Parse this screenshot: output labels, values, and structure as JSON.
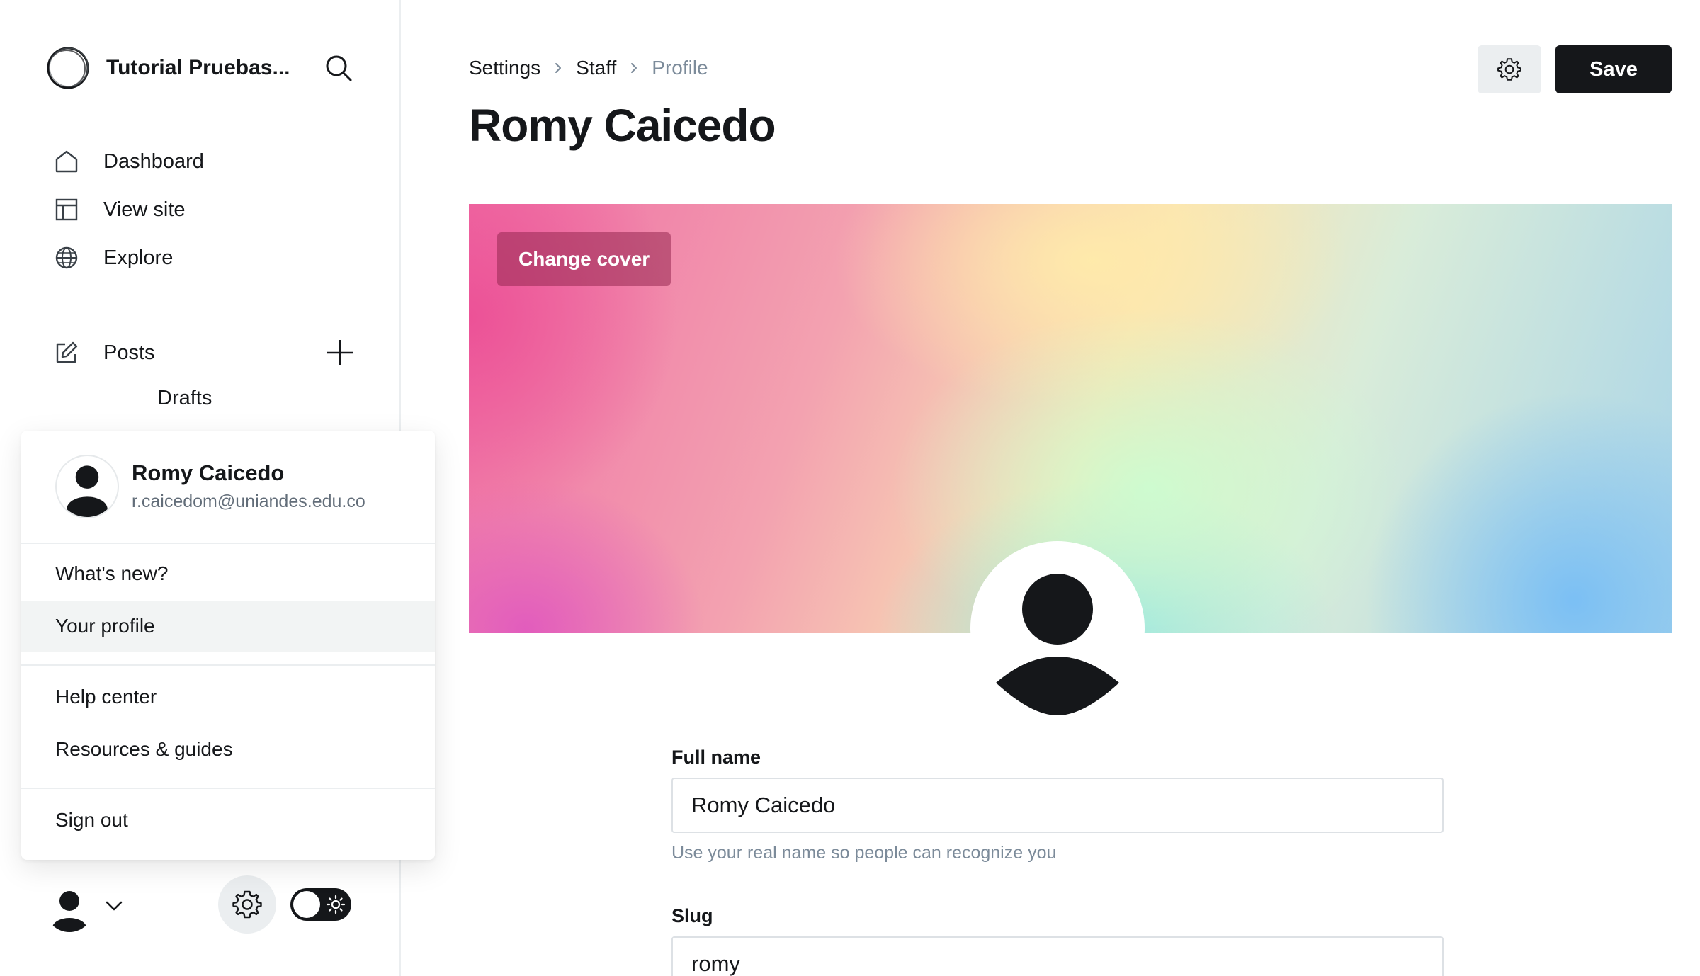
{
  "sidebar": {
    "site_title": "Tutorial Pruebas...",
    "nav": {
      "dashboard": "Dashboard",
      "view_site": "View site",
      "explore": "Explore",
      "posts": "Posts",
      "drafts": "Drafts"
    }
  },
  "user_menu": {
    "name": "Romy Caicedo",
    "email": "r.caicedom@uniandes.edu.co",
    "items": {
      "whats_new": "What's new?",
      "your_profile": "Your profile",
      "help_center": "Help center",
      "resources": "Resources & guides",
      "sign_out": "Sign out"
    }
  },
  "header": {
    "breadcrumb": [
      "Settings",
      "Staff",
      "Profile"
    ],
    "title": "Romy Caicedo",
    "save_label": "Save"
  },
  "cover": {
    "change_cover_label": "Change cover"
  },
  "form": {
    "full_name": {
      "label": "Full name",
      "value": "Romy Caicedo",
      "hint": "Use your real name so people can recognize you"
    },
    "slug": {
      "label": "Slug",
      "value": "romy"
    }
  },
  "colors": {
    "primary": "#15171a",
    "muted": "#7c8b9a",
    "border": "#ebeef0"
  },
  "icons": [
    "ghost-logo-icon",
    "search-icon",
    "home-icon",
    "layout-icon",
    "globe-icon",
    "edit-icon",
    "plus-icon",
    "avatar-icon",
    "chevron-down-icon",
    "gear-icon",
    "sun-icon",
    "chevron-right-icon"
  ]
}
